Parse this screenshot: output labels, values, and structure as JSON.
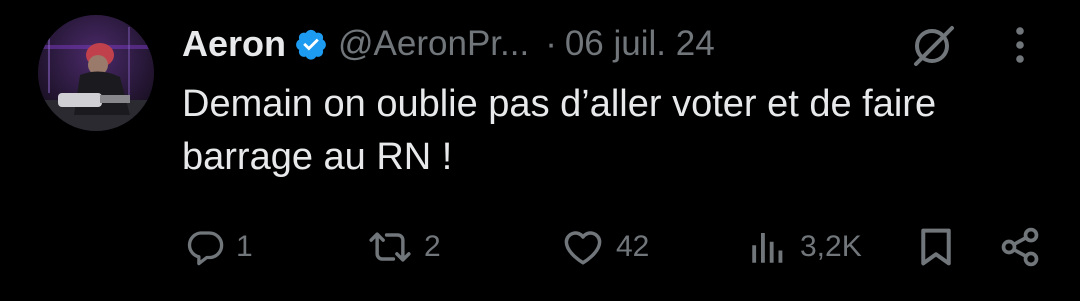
{
  "tweet": {
    "author": {
      "display_name": "Aeron",
      "handle": "@AeronPr...",
      "verified": true
    },
    "separator": "·",
    "date": "06 juil. 24",
    "text": "Demain on oublie pas d’aller voter et de faire barrage au RN !",
    "actions": {
      "replies": "1",
      "reposts": "2",
      "likes": "42",
      "views": "3,2K"
    }
  },
  "colors": {
    "background": "#000000",
    "text_primary": "#e7e9ea",
    "text_secondary": "#71767b",
    "verified_badge": "#1d9bf0"
  },
  "icons": [
    "verified-badge-icon",
    "grok-icon",
    "more-icon",
    "reply-icon",
    "repost-icon",
    "like-icon",
    "views-icon",
    "bookmark-icon",
    "share-icon"
  ]
}
